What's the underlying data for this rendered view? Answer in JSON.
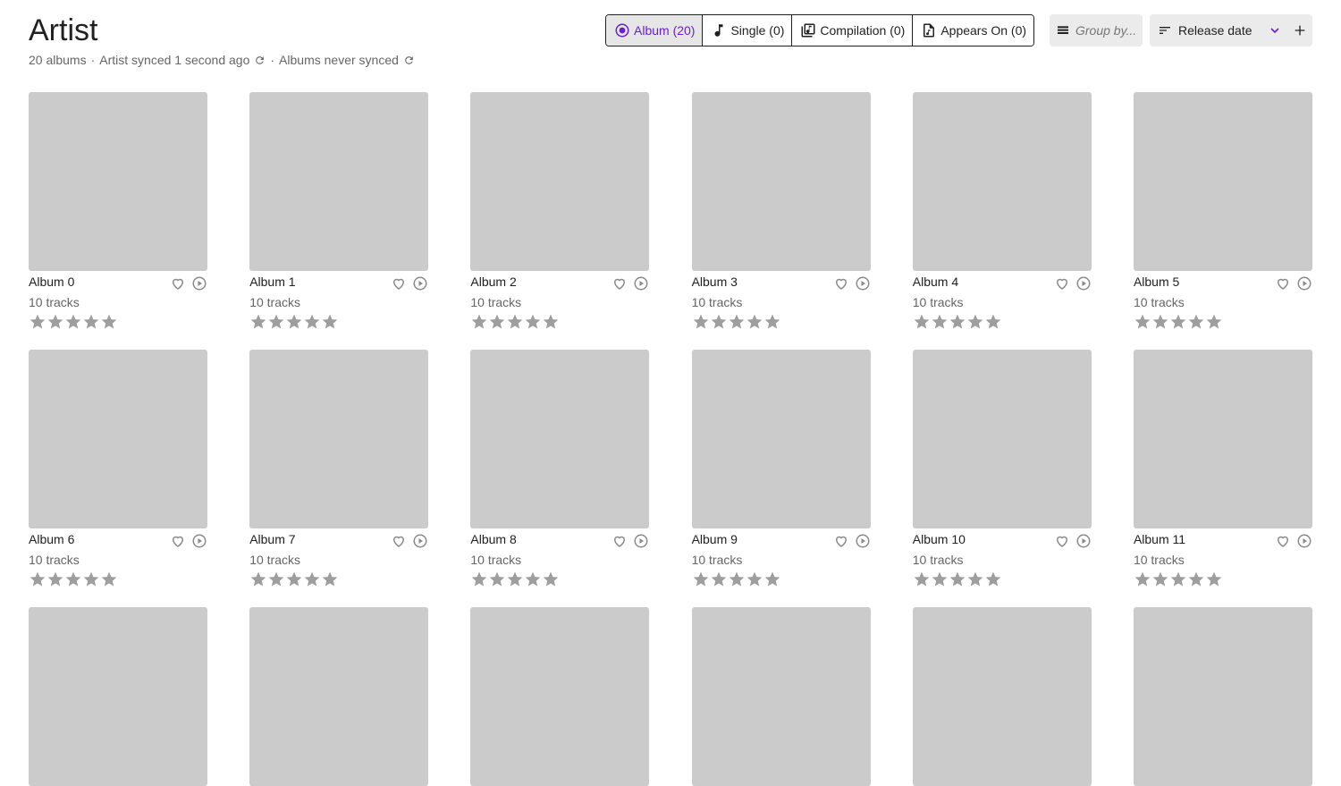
{
  "header": {
    "title": "Artist",
    "album_count": "20 albums",
    "artist_sync": "Artist synced 1 second ago",
    "albums_sync": "Albums never synced"
  },
  "filters": [
    {
      "label": "Album (20)",
      "icon": "album-icon"
    },
    {
      "label": "Single (0)",
      "icon": "music-note-icon"
    },
    {
      "label": "Compilation (0)",
      "icon": "library-music-icon"
    },
    {
      "label": "Appears On (0)",
      "icon": "audio-file-icon"
    }
  ],
  "group_by": {
    "placeholder": "Group by..."
  },
  "sort": {
    "label": "Release date"
  },
  "albums": [
    {
      "name": "Album 0",
      "tracks": "10 tracks"
    },
    {
      "name": "Album 1",
      "tracks": "10 tracks"
    },
    {
      "name": "Album 2",
      "tracks": "10 tracks"
    },
    {
      "name": "Album 3",
      "tracks": "10 tracks"
    },
    {
      "name": "Album 4",
      "tracks": "10 tracks"
    },
    {
      "name": "Album 5",
      "tracks": "10 tracks"
    },
    {
      "name": "Album 6",
      "tracks": "10 tracks"
    },
    {
      "name": "Album 7",
      "tracks": "10 tracks"
    },
    {
      "name": "Album 8",
      "tracks": "10 tracks"
    },
    {
      "name": "Album 9",
      "tracks": "10 tracks"
    },
    {
      "name": "Album 10",
      "tracks": "10 tracks"
    },
    {
      "name": "Album 11",
      "tracks": "10 tracks"
    },
    {
      "name": "",
      "tracks": ""
    },
    {
      "name": "",
      "tracks": ""
    },
    {
      "name": "",
      "tracks": ""
    },
    {
      "name": "",
      "tracks": ""
    },
    {
      "name": "",
      "tracks": ""
    },
    {
      "name": "",
      "tracks": ""
    }
  ],
  "colors": {
    "accent": "#6a1fd1",
    "cover": "#cbcbcb",
    "star": "#9e9e9e",
    "text_muted": "#666666"
  }
}
